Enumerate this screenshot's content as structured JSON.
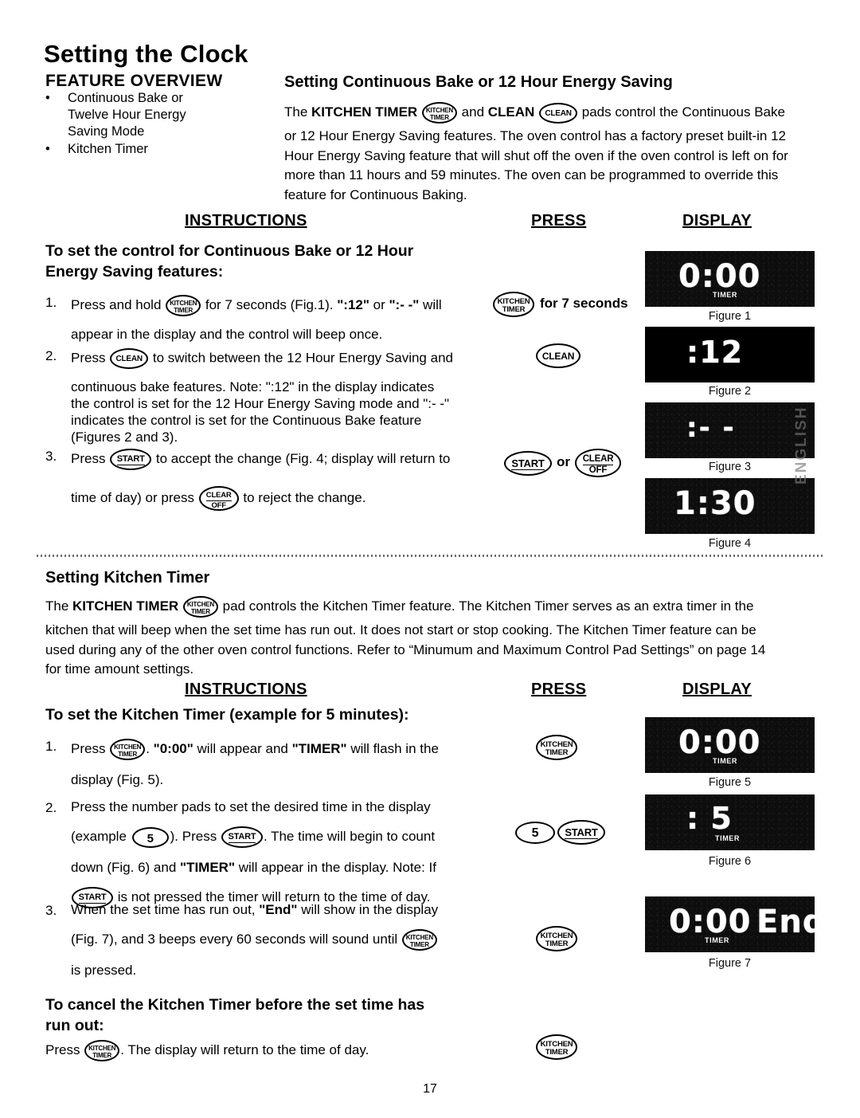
{
  "page": {
    "title": "Setting the Clock",
    "page_number": "17",
    "side_tab": "ENGLISH"
  },
  "feature_overview": {
    "heading": "FEATURE OVERVIEW",
    "bullet": "•",
    "items": [
      "Continuous Bake or Twelve Hour Energy Saving Mode",
      "Kitchen Timer"
    ],
    "item_lines": [
      [
        "Continuous Bake or",
        "Twelve Hour Energy",
        "Saving Mode"
      ],
      [
        "Kitchen Timer"
      ]
    ]
  },
  "column_headers": {
    "instructions": "INSTRUCTIONS",
    "press": "PRESS",
    "display": "DISPLAY"
  },
  "section1": {
    "heading": "Setting Continuous Bake or 12 Hour Energy Saving",
    "intro_line1_a": "The ",
    "intro_line1_kitchen_timer": "KITCHEN TIMER",
    "intro_line1_b": " and ",
    "intro_line1_clean": "CLEAN",
    "intro_line1_c": " pads control the Continuous Bake",
    "intro_rest": [
      "or 12 Hour Energy Saving features. The oven control has a factory preset built-in 12",
      "Hour Energy Saving feature that will shut off the oven if the oven control is left on for",
      "more than 11 hours and 59 minutes. The oven can be programmed to override this",
      "feature for Continuous Baking."
    ],
    "subheading_lines": [
      "To set the control for Continuous Bake or 12 Hour",
      "Energy Saving features:"
    ],
    "steps": [
      {
        "num": "1.",
        "line1_a": "Press and hold ",
        "line1_b": " for 7 seconds (Fig.1). ",
        "line1_quote1": "\":12\"",
        "line1_c": " or ",
        "line1_quote2": "\":- -\"",
        "line1_d": "  will",
        "line2": "appear in the display and the control will beep once.",
        "press_label": "for 7 seconds"
      },
      {
        "num": "2.",
        "line1_a": "Press ",
        "line1_b": " to switch between the 12 Hour Energy Saving and",
        "lines": [
          "continuous bake features. Note: \":12\" in the display indicates",
          "the control is set for the 12 Hour Energy Saving mode and \":- -\"",
          "indicates the control is set for the Continuous Bake feature",
          "(Figures 2 and 3)."
        ]
      },
      {
        "num": "3.",
        "line1_a": "Press ",
        "line1_b": " to accept the change (Fig. 4; display will return to",
        "line2_a": "time of day) or press ",
        "line2_b": " to reject the change.",
        "press_or": "or"
      }
    ],
    "figures": [
      {
        "caption": "Figure 1",
        "digits": "0:00",
        "timer_label": "TIMER",
        "style": "textured"
      },
      {
        "caption": "Figure 2",
        "digits": ":12",
        "timer_label": "",
        "style": "solid"
      },
      {
        "caption": "Figure 3",
        "digits": ":- -",
        "timer_label": "",
        "style": "textured"
      },
      {
        "caption": "Figure 4",
        "digits": "1:30",
        "timer_label": "",
        "style": "textured"
      }
    ]
  },
  "section2": {
    "heading": "Setting Kitchen Timer",
    "intro_line1_a": "The ",
    "intro_line1_kitchen_timer": "KITCHEN TIMER",
    "intro_line1_b": " pad controls the Kitchen Timer feature. The Kitchen Timer serves as an extra timer in the",
    "intro_rest": [
      "kitchen that will beep when the set time has run out.  It does not start or stop cooking.  The Kitchen Timer feature can be",
      "used during any of the other oven control functions. Refer to “Minumum and Maximum Control Pad Settings” on page 14",
      "for time amount settings."
    ],
    "subheading": "To set the Kitchen Timer (example for 5 minutes):",
    "steps": [
      {
        "num": "1.",
        "line1_a": "Press ",
        "line1_b": ". ",
        "line1_q1": "\"0:00\"",
        "line1_c": " will appear and ",
        "line1_q2": "\"TIMER\"",
        "line1_d": " will flash in the",
        "line2": "display (Fig. 5)."
      },
      {
        "num": "2.",
        "line1": "Press the number pads to set the desired time in the display",
        "line2_a": "(example ",
        "line2_b": "). ",
        "line2_c": " Press ",
        "line2_d": ". The time will begin to count",
        "line3_a": "down (Fig. 6) and ",
        "line3_q": "\"TIMER\"",
        "line3_b": " will appear in the display.  Note: If",
        "line4_b": " is not pressed the timer will return to the time of day.",
        "number_pad": "5"
      },
      {
        "num": "3.",
        "line1_a": "When the set time has run out, ",
        "line1_q": "\"End\"",
        "line1_b": " will show in the display",
        "line2_a": "(Fig. 7), and 3 beeps every 60 seconds will sound until ",
        "line3": "is pressed."
      }
    ],
    "figures": [
      {
        "caption": "Figure 5",
        "digits": "0:00",
        "timer_label": "TIMER",
        "style": "textured"
      },
      {
        "caption": "Figure 6",
        "digits": ": 5",
        "timer_label": "TIMER",
        "style": "textured"
      },
      {
        "caption": "Figure 7",
        "digits": "0:00",
        "digits2": "End",
        "timer_label": "TIMER",
        "style": "textured"
      }
    ]
  },
  "section3": {
    "subheading_lines": [
      "To cancel the Kitchen Timer before the set time has",
      "run out:"
    ],
    "line_a": "Press ",
    "line_b": ".  The display will return to the time of day."
  },
  "pads": {
    "kitchen_timer_l1": "KITCHEN",
    "kitchen_timer_l2": "TIMER",
    "clean": "CLEAN",
    "start": "START",
    "clear_l1": "CLEAR",
    "clear_l2": "OFF",
    "number_five": "5"
  }
}
